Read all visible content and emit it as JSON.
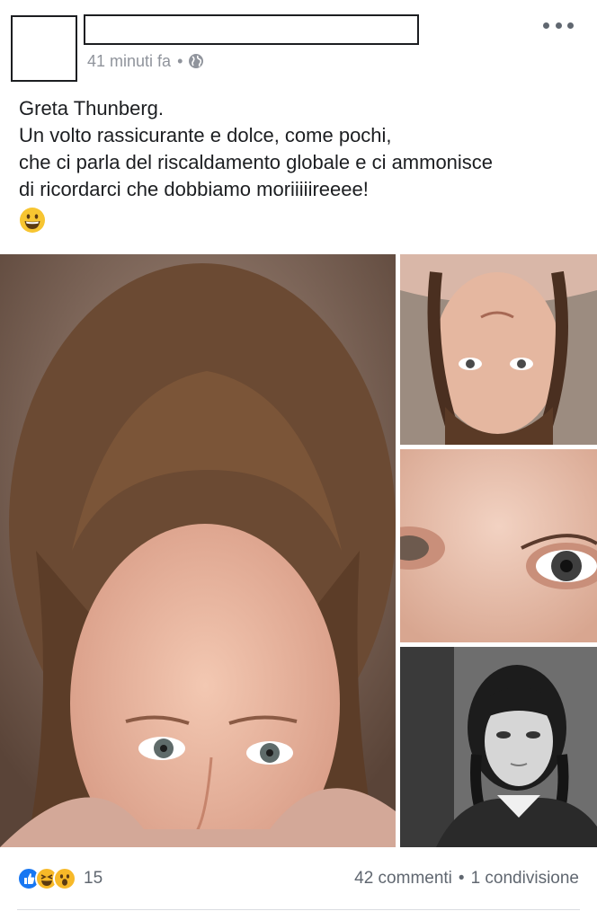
{
  "post": {
    "timestamp": "41 minuti fa",
    "separator": "•",
    "privacy_icon": "globe-icon",
    "menu_icon": "more-options-icon",
    "text_lines": [
      "Greta Thunberg.",
      "Un volto rassicurante e dolce, come pochi,",
      "che ci parla del riscaldamento globale e ci ammonisce",
      "di ricordarci che dobbiamo moriiiiireeee!"
    ],
    "emoji": "grinning-face-emoji"
  },
  "photos": [
    {
      "name": "photo-greta-portrait",
      "subject": "portrait"
    },
    {
      "name": "photo-greta-upside-down",
      "subject": "portrait-upside-down"
    },
    {
      "name": "photo-eyes-closeup",
      "subject": "eyes-closeup"
    },
    {
      "name": "photo-black-white-girl",
      "subject": "black-white-portrait"
    }
  ],
  "reactions": {
    "icons": [
      "like-icon",
      "laugh-icon",
      "wow-icon"
    ],
    "count": "15"
  },
  "stats": {
    "comments": "42 commenti",
    "separator": "•",
    "shares": "1 condivisione"
  },
  "colors": {
    "text": "#1c1e21",
    "meta": "#90949c",
    "like_blue": "#1877f2",
    "reaction_yellow": "#f7b928"
  }
}
